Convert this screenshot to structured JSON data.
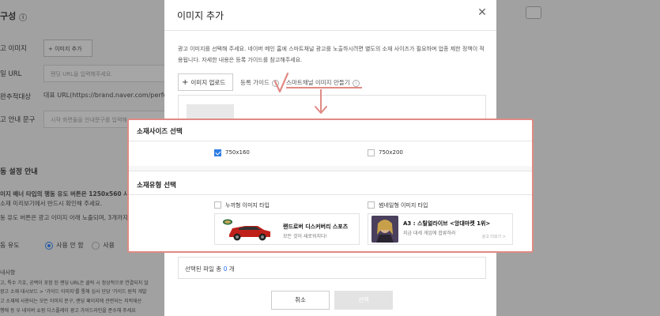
{
  "background": {
    "section_title": "구성",
    "rows": [
      {
        "label": "고 이미지",
        "button": "+ 이미지 추가"
      },
      {
        "label": "일 URL",
        "placeholder": "랜딩 URL을 입력해주세요."
      },
      {
        "label": "완추적대상",
        "value": "대표 URL(https://brand.naver.com/perfect_v)"
      },
      {
        "label": "고 안내 문구",
        "placeholder": "시작 화면들을 안내문구를 입력해"
      }
    ],
    "section2_title": "동 설정 안내",
    "note1": "이지 배너 타입의 행동 유도 버튼은 1250x560 사이즈",
    "note2": "소재 미리보기에서 반드시 확인해 주세요.",
    "note3": "동 유도 버튼은 광고 이미지 아래 노출되며, 3개까지 등",
    "radio_label": "동 유도",
    "radio_on": "사용 안 함",
    "radio_off": "사용",
    "bottom_notes": [
      "내사항",
      "고, 특수 기호, 공백이 포함 된 랜딩 URL은 클릭 시 정상적으로 연결되지 않",
      "광고 소재 대시보드 > '가이드 이미지'를 통해 심사 단당 '가이드 원칙 개발",
      "고 소재에 사용되는 모든 이미지 문구, 랜딩 페이지에 관련되는 지적재산",
      "행에 등 우 네이버 쇼핑 디스플레이 광고 가이드라인을 준수해 주세요"
    ]
  },
  "modal": {
    "title": "이미지 추가",
    "description": "광고 이미지를 선택해 주세요. 네이버 메인 홈에 스마트채널 광고를 노출하시려면 별도의 소재 사이즈가 필요하며 업종 제한 정책이 적용됩니다. 자세한 내용은 등록 가이드를 참고해주세요.",
    "upload_button": "이미지 업로드",
    "guide_link": "등록 가이드",
    "smartchannel_link": "스마트채널 이미지 만들기",
    "selected_prefix": "선택된 파일 총",
    "selected_count": "0",
    "selected_suffix": "개",
    "cancel": "취소",
    "confirm": "선택"
  },
  "panel": {
    "size_title": "소재사이즈 선택",
    "size_options": [
      {
        "label": "750x160",
        "checked": true
      },
      {
        "label": "750x200",
        "checked": false
      }
    ],
    "type_title": "소재유형 선택",
    "type_options": [
      {
        "label": "누끼형 이미지 타입"
      },
      {
        "label": "썸네일형 이미지 타입"
      }
    ],
    "card1": {
      "title": "랜드로버 디스커버리 스포츠",
      "sub": "모든 것이 새로워지다!"
    },
    "card2": {
      "title": "A3 : 스틸얼라이브 <앙대마켓 1위>",
      "sub": "지금 대세 게임에 합류하라",
      "more": "광고 더보기 >"
    }
  },
  "colors": {
    "accent": "#2f7ee5",
    "annotation": "#e08a84",
    "count_blue": "#1e6fff"
  }
}
